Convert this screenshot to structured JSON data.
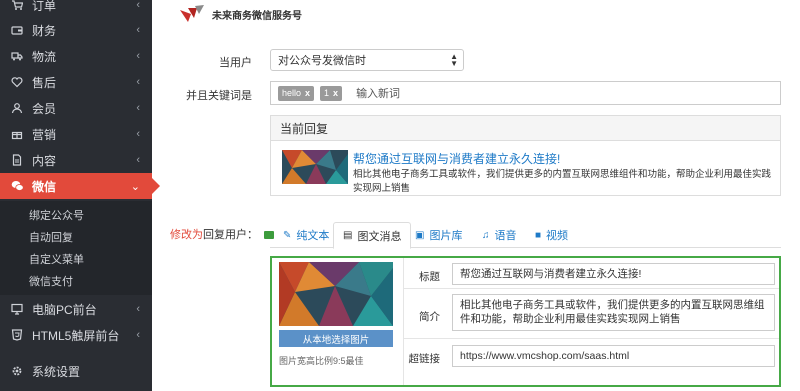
{
  "sidebar": {
    "items": [
      {
        "label": "订单",
        "icon": "cart-icon"
      },
      {
        "label": "财务",
        "icon": "wallet-icon"
      },
      {
        "label": "物流",
        "icon": "truck-icon"
      },
      {
        "label": "售后",
        "icon": "heart-icon"
      },
      {
        "label": "会员",
        "icon": "user-icon"
      },
      {
        "label": "营销",
        "icon": "gift-icon"
      },
      {
        "label": "内容",
        "icon": "document-icon"
      },
      {
        "label": "微信",
        "icon": "wechat-icon"
      }
    ],
    "sub_items": [
      {
        "label": "绑定公众号"
      },
      {
        "label": "自动回复"
      },
      {
        "label": "自定义菜单"
      },
      {
        "label": "微信支付"
      }
    ],
    "bottom_items": [
      {
        "label": "电脑PC前台",
        "icon": "monitor-icon"
      },
      {
        "label": "HTML5触屏前台",
        "icon": "html5-icon"
      },
      {
        "label": "系统设置",
        "icon": "gear-icon"
      }
    ],
    "active": "微信",
    "colors": {
      "background": "#2a2d33",
      "active": "#e24a3b"
    }
  },
  "header": {
    "brand_name": "未来商务微信服务号"
  },
  "form": {
    "user_label": "当用户",
    "user_select_value": "对公众号发微信时",
    "keyword_label": "并且关键词是",
    "keywords": [
      "hello",
      "1"
    ],
    "keyword_remove": "x",
    "keyword_placeholder": "输入新词"
  },
  "current_reply": {
    "heading": "当前回复",
    "title": "帮您通过互联网与消费者建立永久连接!",
    "description": "相比其他电子商务工具或软件，我们提供更多的内置互联网思维组件和功能，帮助企业利用最佳实践实现网上销售"
  },
  "modify": {
    "link": "修改为",
    "label": "回复用户："
  },
  "tabs": [
    {
      "label": "纯文本",
      "icon": "edit-icon"
    },
    {
      "label": "图文消息",
      "icon": "news-icon",
      "active": true
    },
    {
      "label": "图片库",
      "icon": "image-icon"
    },
    {
      "label": "语音",
      "icon": "audio-icon"
    },
    {
      "label": "视频",
      "icon": "video-icon"
    }
  ],
  "editor": {
    "upload_button": "从本地选择图片",
    "hint": "图片宽高比例9:5最佳",
    "title_label": "标题",
    "title_value": "帮您通过互联网与消费者建立永久连接!",
    "summary_label": "简介",
    "summary_value": "相比其他电子商务工具或软件，我们提供更多的内置互联网思维组件和功能，帮助企业利用最佳实践实现网上销售",
    "link_label": "超链接",
    "link_value": "https://www.vmcshop.com/saas.html",
    "border_color": "#46a946"
  }
}
